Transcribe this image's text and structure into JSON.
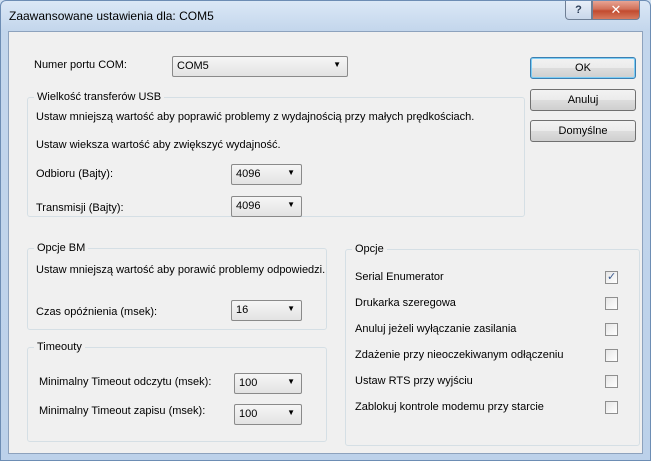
{
  "window": {
    "title": "Zaawansowane ustawienia dla: COM5",
    "help_label": "?",
    "close_label": "✕"
  },
  "com_port": {
    "label": "Numer portu COM:",
    "value": "COM5"
  },
  "usb": {
    "title": "Wielkość transferów USB",
    "desc1": "Ustaw mniejszą wartość aby poprawić problemy z wydajnością przy małych prędkościach.",
    "desc2": "Ustaw wieksza wartość aby zwiększyć wydajność.",
    "receive_label": "Odbioru (Bajty):",
    "receive_value": "4096",
    "transmit_label": "Transmisji (Bajty):",
    "transmit_value": "4096"
  },
  "bm": {
    "title": "Opcje BM",
    "desc": "Ustaw mniejszą wartość aby porawić problemy odpowiedzi.",
    "latency_label": "Czas opóźnienia (msek):",
    "latency_value": "16"
  },
  "timeouts": {
    "title": "Timeouty",
    "read_label": "Minimalny Timeout odczytu (msek):",
    "read_value": "100",
    "write_label": "Minimalny Timeout zapisu (msek):",
    "write_value": "100"
  },
  "options": {
    "title": "Opcje",
    "items": [
      {
        "label": "Serial Enumerator",
        "checked": true
      },
      {
        "label": "Drukarka szeregowa",
        "checked": false
      },
      {
        "label": "Anuluj jeżeli wyłączanie zasilania",
        "checked": false
      },
      {
        "label": "Zdażenie przy nieoczekiwanym odłączeniu",
        "checked": false
      },
      {
        "label": "Ustaw RTS przy wyjściu",
        "checked": false
      },
      {
        "label": "Zablokuj kontrole modemu przy starcie",
        "checked": false
      }
    ]
  },
  "buttons": {
    "ok": "OK",
    "cancel": "Anuluj",
    "defaults": "Domyślne"
  }
}
